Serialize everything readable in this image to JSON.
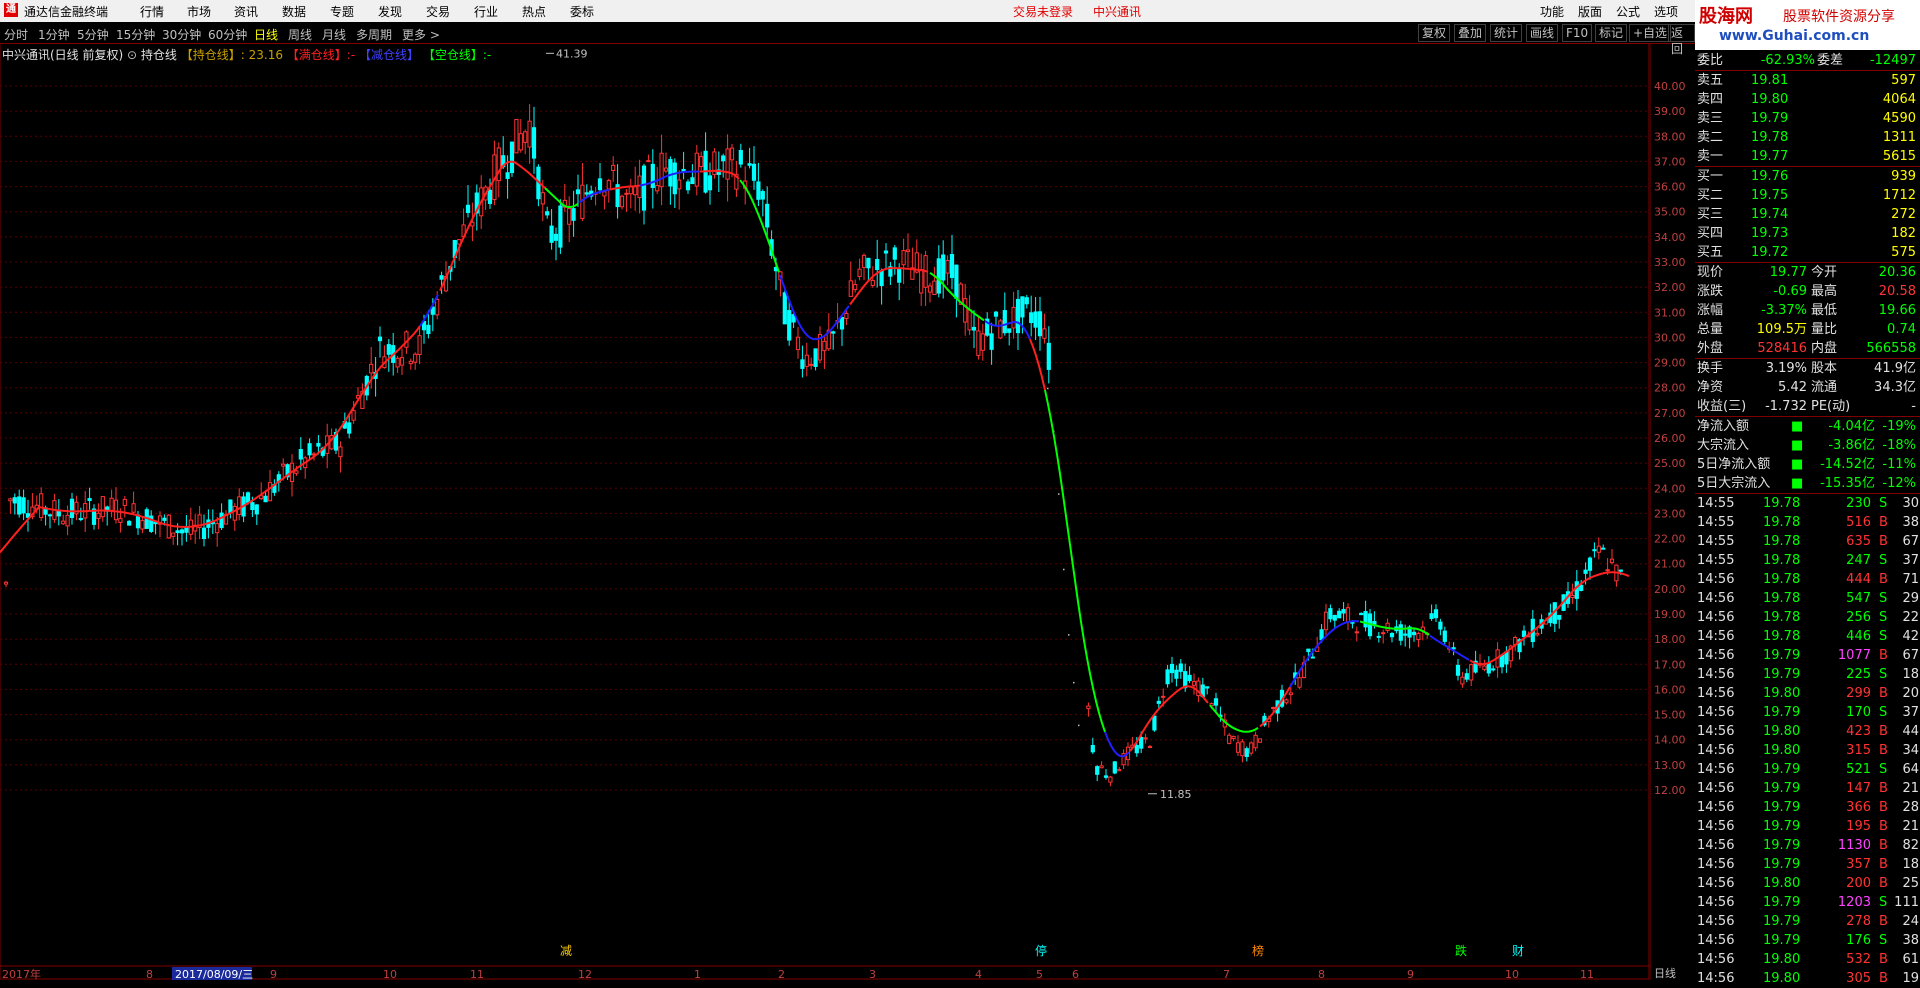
{
  "window": {
    "app_title": "通达信金融终端",
    "menus": [
      "行情",
      "市场",
      "资讯",
      "数据",
      "专题",
      "发现",
      "交易",
      "行业",
      "热点",
      "委标"
    ],
    "trade_status": "交易未登录",
    "stock_link": "中兴通讯",
    "right_menus": [
      "功能",
      "版面",
      "公式",
      "选项"
    ]
  },
  "banner": {
    "line1": "股海网",
    "line2": "股票软件资源分享",
    "line3": "www.Guhai.com.cn"
  },
  "periods": [
    "分时",
    "1分钟",
    "5分钟",
    "15分钟",
    "30分钟",
    "60分钟",
    "日线",
    "周线",
    "月线",
    "多周期",
    "更多 >"
  ],
  "active_period": "日线",
  "tools": [
    "复权",
    "叠加",
    "统计",
    "画线",
    "F10",
    "标记",
    "+自选",
    "返回"
  ],
  "indicator": {
    "name": "中兴通讯(日线 前复权)",
    "formula": "持仓线",
    "param1": "【持仓线】: 23.16",
    "param2": "【满仓线】:-",
    "param3": "【减仓线】",
    "param4": "【空仓线】:-"
  },
  "chart_data": {
    "type": "candlestick",
    "ylim": [
      11.5,
      41.5
    ],
    "y_ticks": [
      "40.00",
      "39.00",
      "38.00",
      "37.00",
      "36.00",
      "35.00",
      "34.00",
      "33.00",
      "32.00",
      "31.00",
      "30.00",
      "29.00",
      "28.00",
      "27.00",
      "26.00",
      "25.00",
      "24.00",
      "23.00",
      "22.00",
      "21.00",
      "20.00",
      "19.00",
      "18.00",
      "17.00",
      "16.00",
      "15.00",
      "14.00",
      "13.00",
      "12.00"
    ],
    "x_labels": [
      "2017年",
      "8",
      "2017/08/09/三",
      "9",
      "10",
      "11",
      "12",
      "1",
      "2",
      "3",
      "4",
      "5",
      "6",
      "7",
      "8",
      "9",
      "10",
      "11",
      "日线"
    ],
    "high_marker": "41.39",
    "low_marker": "11.85",
    "event_markers": [
      "减",
      "停",
      "榜",
      "跌",
      "财"
    ],
    "colors": {
      "up": "#ff3333",
      "down": "#00ffff",
      "line_hold": "#ff2020",
      "line_reduce": "#2020ff",
      "line_empty": "#00ff00"
    }
  },
  "quote": {
    "header": {
      "label1": "委比",
      "value1": "-62.93%",
      "label2": "委差",
      "value2": "-12497"
    },
    "asks": [
      {
        "label": "卖五",
        "price": "19.81",
        "vol": "597"
      },
      {
        "label": "卖四",
        "price": "19.80",
        "vol": "4064"
      },
      {
        "label": "卖三",
        "price": "19.79",
        "vol": "4590"
      },
      {
        "label": "卖二",
        "price": "19.78",
        "vol": "1311"
      },
      {
        "label": "卖一",
        "price": "19.77",
        "vol": "5615"
      }
    ],
    "bids": [
      {
        "label": "买一",
        "price": "19.76",
        "vol": "939"
      },
      {
        "label": "买二",
        "price": "19.75",
        "vol": "1712"
      },
      {
        "label": "买三",
        "price": "19.74",
        "vol": "272"
      },
      {
        "label": "买四",
        "price": "19.73",
        "vol": "182"
      },
      {
        "label": "买五",
        "price": "19.72",
        "vol": "575"
      }
    ],
    "stats": [
      {
        "l1": "现价",
        "v1": "19.77",
        "c1": "down",
        "l2": "今开",
        "v2": "20.36",
        "c2": "down"
      },
      {
        "l1": "涨跌",
        "v1": "-0.69",
        "c1": "down",
        "l2": "最高",
        "v2": "20.58",
        "c2": "up"
      },
      {
        "l1": "涨幅",
        "v1": "-3.37%",
        "c1": "down",
        "l2": "最低",
        "v2": "19.66",
        "c2": "down"
      },
      {
        "l1": "总量",
        "v1": "109.5万",
        "c1": "yel",
        "l2": "量比",
        "v2": "0.74",
        "c2": "down"
      },
      {
        "l1": "外盘",
        "v1": "528416",
        "c1": "up",
        "l2": "内盘",
        "v2": "566558",
        "c2": "down"
      }
    ],
    "stats2": [
      {
        "l1": "换手",
        "v1": "3.19%",
        "l2": "股本",
        "v2": "41.9亿"
      },
      {
        "l1": "净资",
        "v1": "5.42",
        "l2": "流通",
        "v2": "34.3亿"
      },
      {
        "l1": "收益(三)",
        "v1": "-1.732",
        "l2": "PE(动)",
        "v2": "-"
      }
    ],
    "flows": [
      {
        "label": "净流入额",
        "value": "-4.04亿",
        "pct": "-19%"
      },
      {
        "label": "大宗流入",
        "value": "-3.86亿",
        "pct": "-18%"
      },
      {
        "label": "5日净流入额",
        "value": "-14.52亿",
        "pct": "-11%"
      },
      {
        "label": "5日大宗流入",
        "value": "-15.35亿",
        "pct": "-12%"
      }
    ],
    "ticks": [
      {
        "t": "14:55",
        "p": "19.78",
        "v": "230",
        "s": "S",
        "n": "30"
      },
      {
        "t": "14:55",
        "p": "19.78",
        "v": "516",
        "s": "B",
        "n": "38"
      },
      {
        "t": "14:55",
        "p": "19.78",
        "v": "635",
        "s": "B",
        "n": "67"
      },
      {
        "t": "14:55",
        "p": "19.78",
        "v": "247",
        "s": "S",
        "n": "37"
      },
      {
        "t": "14:56",
        "p": "19.78",
        "v": "444",
        "s": "B",
        "n": "71"
      },
      {
        "t": "14:56",
        "p": "19.78",
        "v": "547",
        "s": "S",
        "n": "29"
      },
      {
        "t": "14:56",
        "p": "19.78",
        "v": "256",
        "s": "S",
        "n": "22"
      },
      {
        "t": "14:56",
        "p": "19.78",
        "v": "446",
        "s": "S",
        "n": "42"
      },
      {
        "t": "14:56",
        "p": "19.79",
        "v": "1077",
        "s": "B",
        "n": "67"
      },
      {
        "t": "14:56",
        "p": "19.79",
        "v": "225",
        "s": "S",
        "n": "18"
      },
      {
        "t": "14:56",
        "p": "19.80",
        "v": "299",
        "s": "B",
        "n": "20"
      },
      {
        "t": "14:56",
        "p": "19.79",
        "v": "170",
        "s": "S",
        "n": "37"
      },
      {
        "t": "14:56",
        "p": "19.80",
        "v": "423",
        "s": "B",
        "n": "44"
      },
      {
        "t": "14:56",
        "p": "19.80",
        "v": "315",
        "s": "B",
        "n": "34"
      },
      {
        "t": "14:56",
        "p": "19.79",
        "v": "521",
        "s": "S",
        "n": "64"
      },
      {
        "t": "14:56",
        "p": "19.79",
        "v": "147",
        "s": "B",
        "n": "21"
      },
      {
        "t": "14:56",
        "p": "19.79",
        "v": "366",
        "s": "B",
        "n": "28"
      },
      {
        "t": "14:56",
        "p": "19.79",
        "v": "195",
        "s": "B",
        "n": "21"
      },
      {
        "t": "14:56",
        "p": "19.79",
        "v": "1130",
        "s": "B",
        "n": "82"
      },
      {
        "t": "14:56",
        "p": "19.79",
        "v": "357",
        "s": "B",
        "n": "18"
      },
      {
        "t": "14:56",
        "p": "19.80",
        "v": "200",
        "s": "B",
        "n": "25"
      },
      {
        "t": "14:56",
        "p": "19.79",
        "v": "1203",
        "s": "S",
        "n": "111"
      },
      {
        "t": "14:56",
        "p": "19.79",
        "v": "278",
        "s": "B",
        "n": "24"
      },
      {
        "t": "14:56",
        "p": "19.79",
        "v": "176",
        "s": "S",
        "n": "38"
      },
      {
        "t": "14:56",
        "p": "19.80",
        "v": "532",
        "s": "B",
        "n": "61"
      },
      {
        "t": "14:56",
        "p": "19.80",
        "v": "305",
        "s": "B",
        "n": "19"
      }
    ]
  }
}
